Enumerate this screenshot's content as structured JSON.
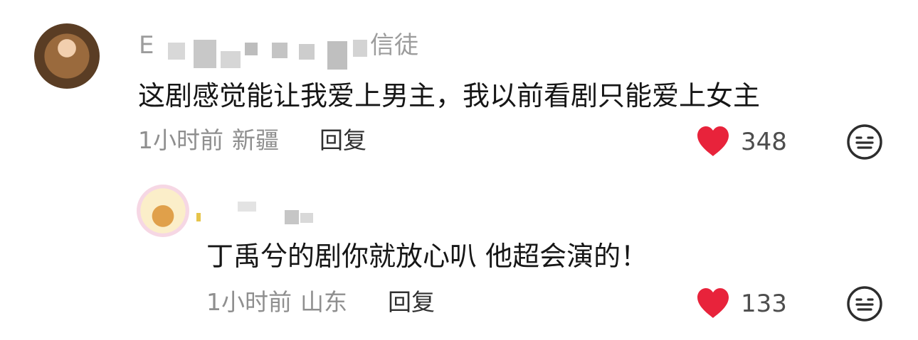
{
  "colors": {
    "like": "#e8233b",
    "meta_text": "#8f8f8f",
    "username": "#9c9c9c",
    "comment_text": "#161616"
  },
  "comments": [
    {
      "username_visible": "E",
      "username_suffix": "信徒",
      "text": "这剧感觉能让我爱上男主，我以前看剧只能爱上女主",
      "time": "1小时前",
      "location": "新疆",
      "reply_label": "回复",
      "likes": "348",
      "like_icon": "heart-filled-icon",
      "dislike_icon": "meh-face-icon"
    },
    {
      "text": "丁禹兮的剧你就放心叭 他超会演的！",
      "time": "1小时前",
      "location": "山东",
      "reply_label": "回复",
      "likes": "133",
      "like_icon": "heart-filled-icon",
      "dislike_icon": "meh-face-icon"
    }
  ]
}
